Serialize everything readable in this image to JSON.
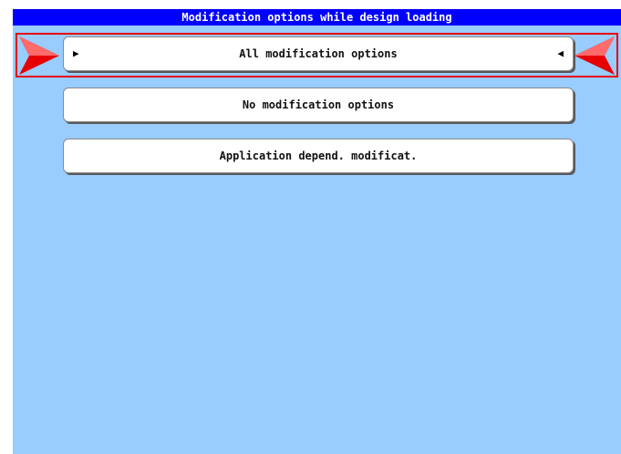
{
  "title": "Modification options while design loading",
  "options": [
    {
      "label": "All modification options",
      "selected": true
    },
    {
      "label": "No modification options",
      "selected": false
    },
    {
      "label": "Application depend. modificat.",
      "selected": false
    }
  ],
  "selected_marker_left": "▶",
  "selected_marker_right": "◀",
  "colors": {
    "title_bg": "#0000ff",
    "screen_bg": "#99ccff",
    "selection": "#e60000"
  },
  "icons": [
    "selection-pointer-left-icon",
    "selection-pointer-right-icon",
    "play-right-icon",
    "play-left-icon"
  ]
}
